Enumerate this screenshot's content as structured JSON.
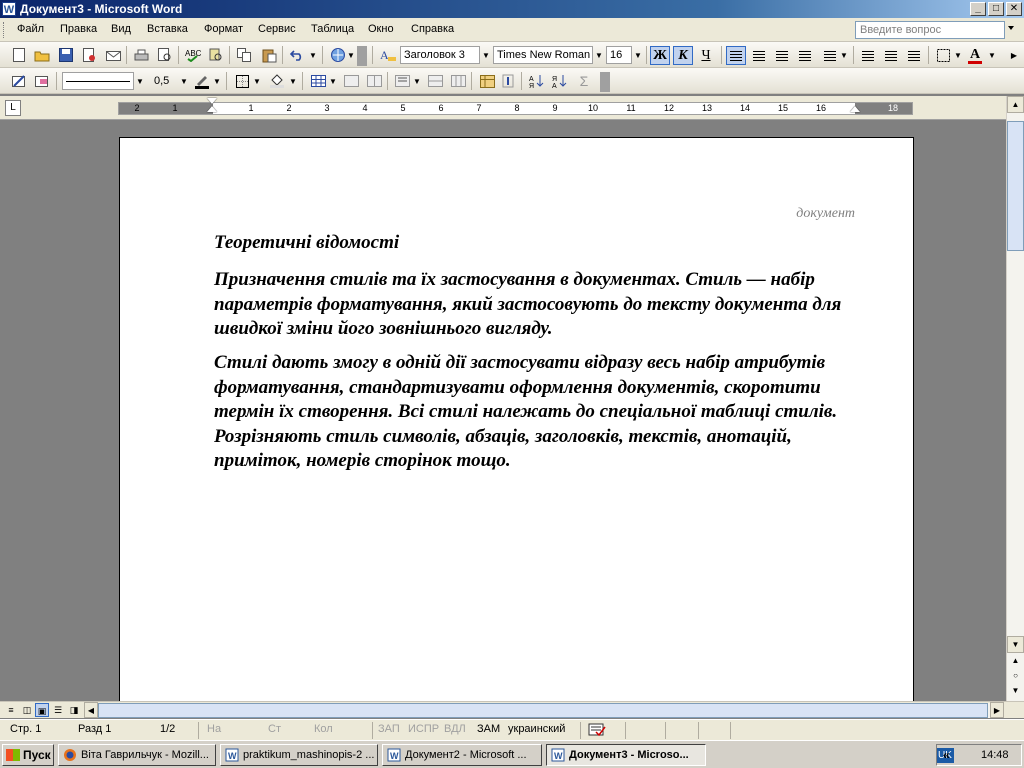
{
  "window": {
    "title": "Документ3 - Microsoft Word",
    "app_icon": "W",
    "min_icon": "_",
    "max_icon": "□",
    "close_icon": "✕"
  },
  "menu": {
    "items": [
      "Файл",
      "Правка",
      "Вид",
      "Вставка",
      "Формат",
      "Сервис",
      "Таблица",
      "Окно",
      "Справка"
    ],
    "ask_placeholder": "Введите вопрос"
  },
  "formatting": {
    "style": "Заголовок 3",
    "font": "Times New Roman",
    "size": "16",
    "bold": "Ж",
    "italic": "К",
    "underline": "Ч",
    "bold_active": true,
    "italic_active": true
  },
  "drawing": {
    "line_weight": "0,5"
  },
  "ruler": {
    "labels": [
      "2",
      "1",
      "1",
      "2",
      "3",
      "4",
      "5",
      "6",
      "7",
      "8",
      "9",
      "10",
      "11",
      "12",
      "13",
      "14",
      "15",
      "16",
      "18"
    ],
    "tab_selector": "L"
  },
  "document": {
    "header": "документ",
    "heading": "Теоретичні відомості",
    "paragraphs": [
      "Призначення стилів та їх застосування в документах. Стиль — набір параметрів форматування, який застосовують до тексту документа для швидкої зміни його зовнішнього вигляду.",
      "Стилі дають змогу в одній дії застосувати відразу весь набір атрибутів форматування, стандартизувати оформлення документів, скоротити термін їх створення. Всі стилі належать до спеціальної таблиці стилів. Розрізняють стиль символів, абзаців, заголовків, текстів, анотацій, приміток, номерів сторінок тощо."
    ]
  },
  "status": {
    "page": "Стр.  1",
    "section": "Разд  1",
    "pages": "1/2",
    "at": "На",
    "line": "Ст",
    "col": "Кол",
    "rec": "ЗАП",
    "trk": "ИСПР",
    "ext": "ВДЛ",
    "ovr": "ЗАМ",
    "language": "украинский"
  },
  "taskbar": {
    "start": "Пуск",
    "items": [
      "Віта Гаврильчук - Mozill...",
      "praktikum_mashinopis-2 ...",
      "Документ2 - Microsoft ...",
      "Документ3 - Microso..."
    ],
    "lang": "UK",
    "chevron": "«",
    "clock": "14:48"
  }
}
